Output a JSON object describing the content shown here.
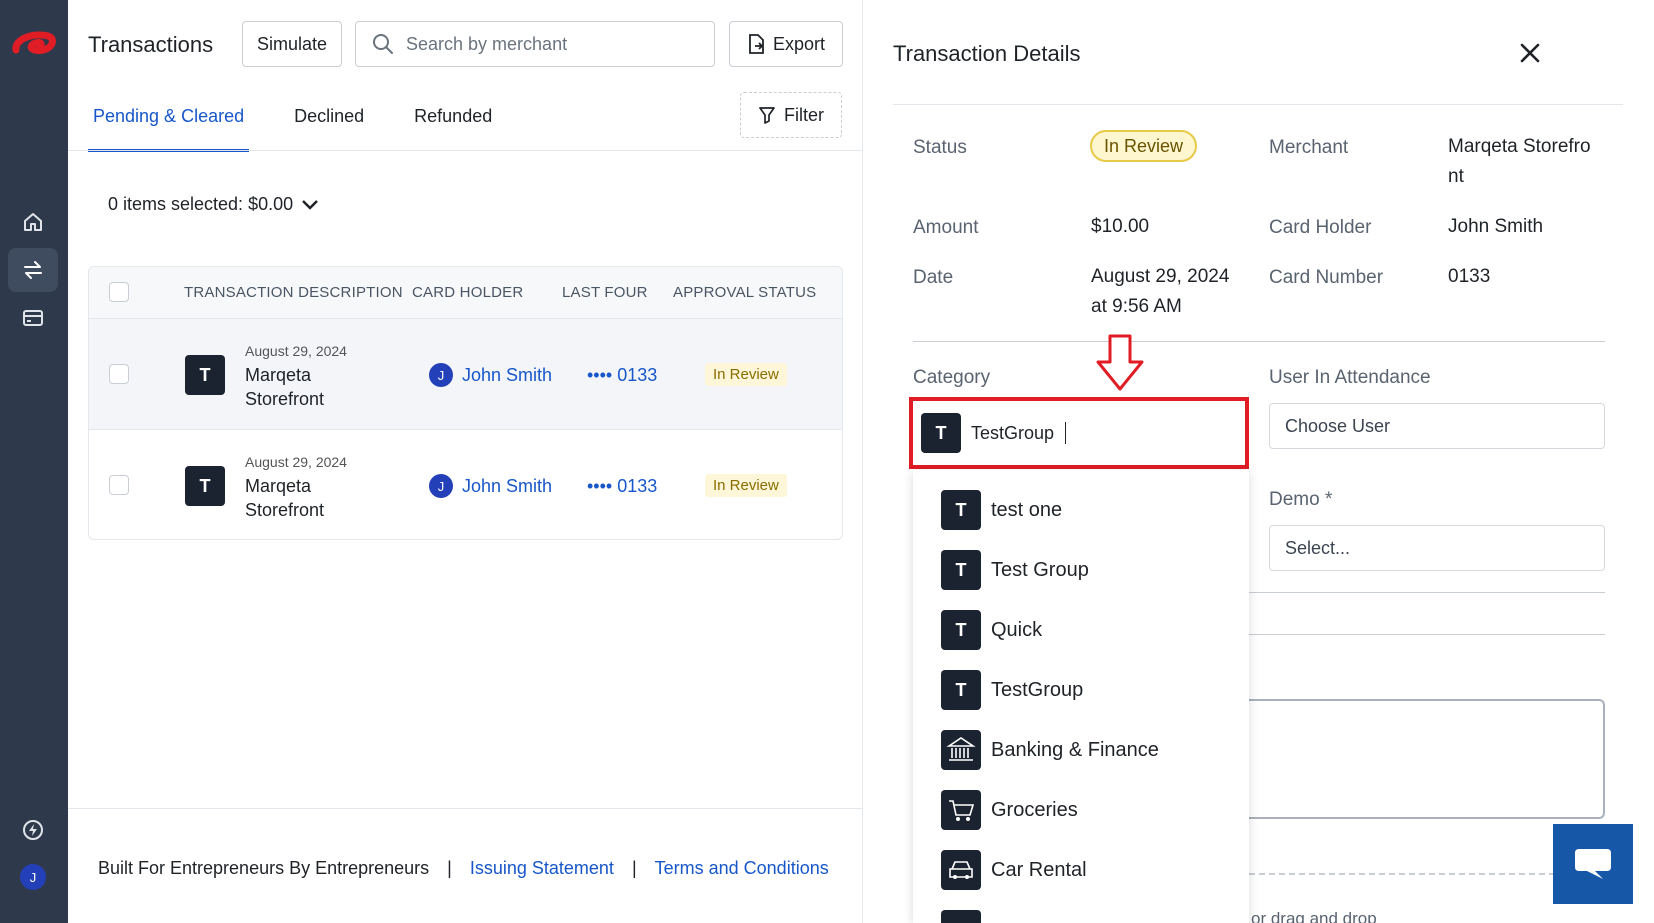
{
  "sidebar": {
    "logo": "brand-logo",
    "user_initial": "J",
    "items": [
      {
        "name": "home",
        "icon": "home-icon",
        "active": false
      },
      {
        "name": "transactions",
        "icon": "transfer-arrows-icon",
        "active": true
      },
      {
        "name": "cards",
        "icon": "card-icon",
        "active": false
      },
      {
        "name": "lightning",
        "icon": "lightning-icon",
        "active": false
      }
    ]
  },
  "header": {
    "title": "Transactions",
    "simulate_label": "Simulate",
    "search_placeholder": "Search by merchant",
    "export_label": "Export"
  },
  "tabs": [
    {
      "label": "Pending & Cleared",
      "active": true
    },
    {
      "label": "Declined",
      "active": false
    },
    {
      "label": "Refunded",
      "active": false
    }
  ],
  "filter_label": "Filter",
  "selection_summary": "0 items selected: $0.00",
  "table": {
    "columns": [
      "TRANSACTION DESCRIPTION",
      "CARD HOLDER",
      "LAST FOUR",
      "APPROVAL STATUS"
    ],
    "rows": [
      {
        "initial": "T",
        "date": "August 29, 2024",
        "merchant": "Marqeta Storefront",
        "holder_initial": "J",
        "holder": "John Smith",
        "last_four": "•••• 0133",
        "status": "In Review"
      },
      {
        "initial": "T",
        "date": "August 29, 2024",
        "merchant": "Marqeta Storefront",
        "holder_initial": "J",
        "holder": "John Smith",
        "last_four": "•••• 0133",
        "status": "In Review"
      }
    ]
  },
  "footer": {
    "tagline": "Built For Entrepreneurs By Entrepreneurs",
    "sep": "|",
    "link1": "Issuing Statement",
    "link2": "Terms and Conditions"
  },
  "details": {
    "title": "Transaction Details",
    "status_label": "Status",
    "status_value": "In Review",
    "merchant_label": "Merchant",
    "merchant_value_line1": "Marqeta Storefro",
    "merchant_value_line2": "nt",
    "amount_label": "Amount",
    "amount_value": "$10.00",
    "card_holder_label": "Card Holder",
    "card_holder_value": "John Smith",
    "date_label": "Date",
    "date_value_line1": "August 29, 2024",
    "date_value_line2": "at 9:56 AM",
    "card_number_label": "Card Number",
    "card_number_value": "0133",
    "category_label": "Category",
    "category_initial": "T",
    "category_input": "TestGroup",
    "user_attendance_label": "User In Attendance",
    "user_attendance_placeholder": "Choose User",
    "demo_label": "Demo *",
    "demo_placeholder": "Select...",
    "dropzone_text": "or drag and drop"
  },
  "category_options": [
    {
      "label": "test one",
      "icon": "letter-t-icon",
      "initial": "T"
    },
    {
      "label": "Test Group",
      "icon": "letter-t-icon",
      "initial": "T"
    },
    {
      "label": "Quick",
      "icon": "letter-t-icon",
      "initial": "T"
    },
    {
      "label": "TestGroup",
      "icon": "letter-t-icon",
      "initial": "T"
    },
    {
      "label": "Banking & Finance",
      "icon": "bank-icon",
      "initial": ""
    },
    {
      "label": "Groceries",
      "icon": "shopping-cart-icon",
      "initial": ""
    },
    {
      "label": "Car Rental",
      "icon": "car-icon",
      "initial": ""
    }
  ],
  "colors": {
    "accent": "#1757c9",
    "rail": "#2e3a4b",
    "highlight_red": "#e01c24",
    "status_badge_bg": "#fdf6cf"
  }
}
